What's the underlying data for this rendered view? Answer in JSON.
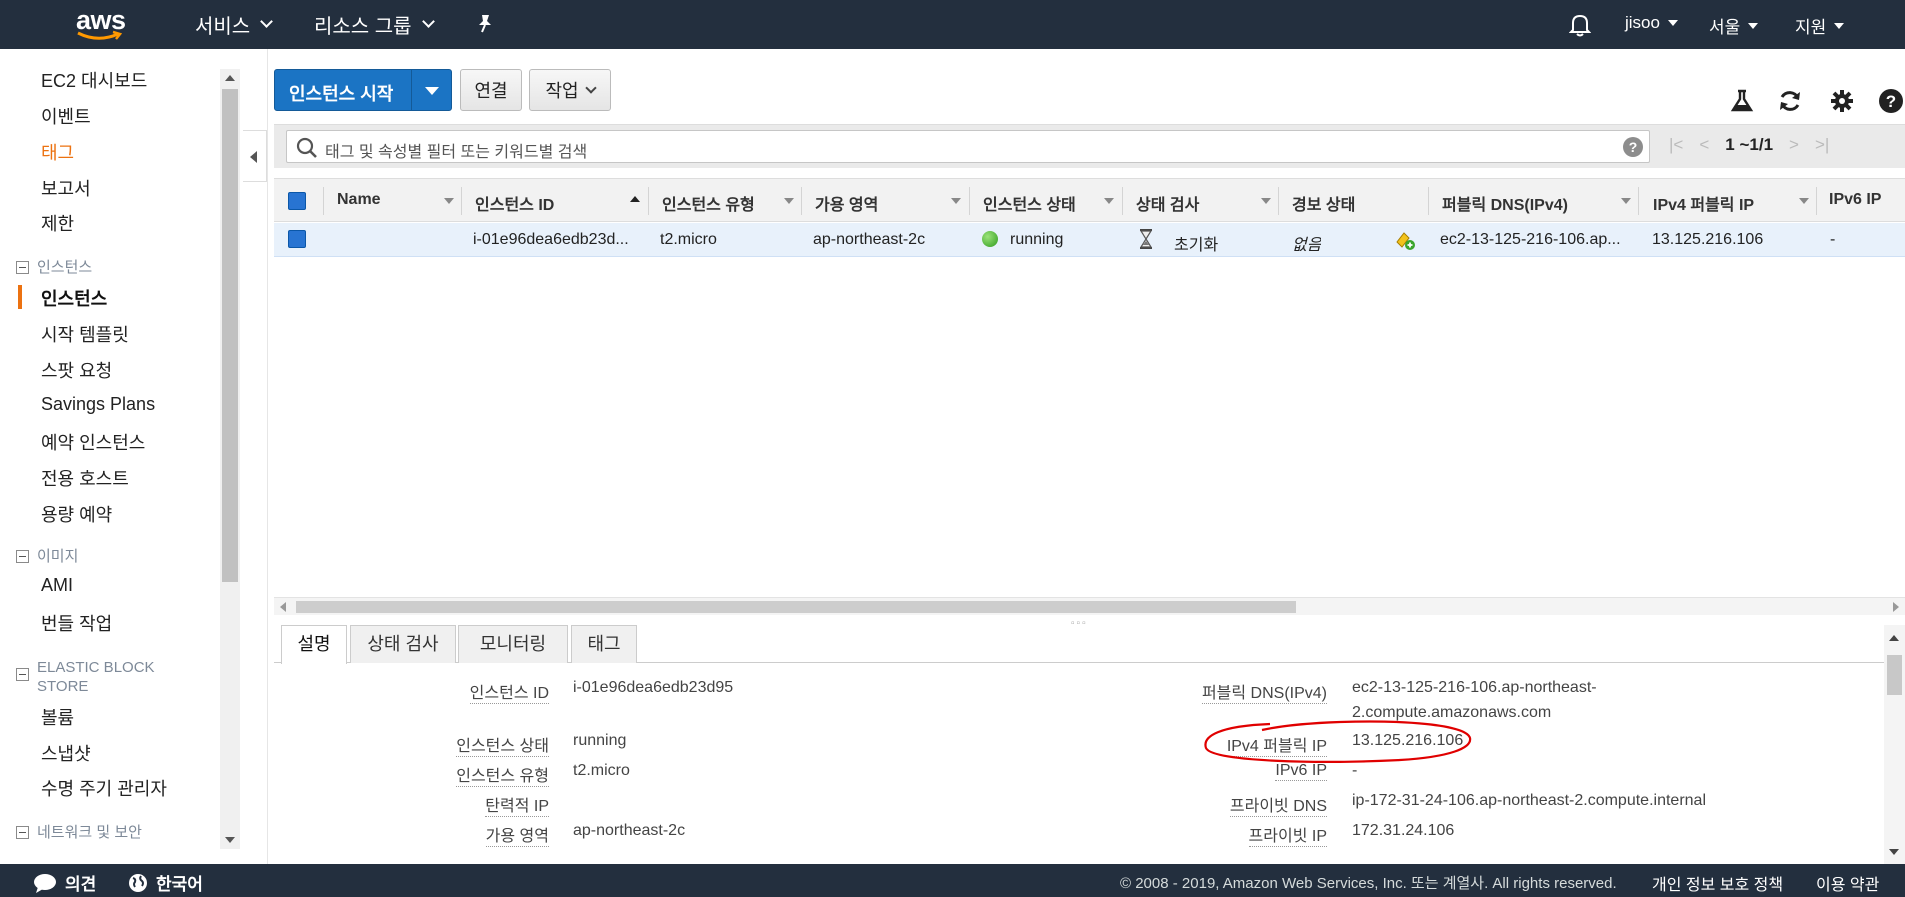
{
  "topnav": {
    "logo_text": "aws",
    "services": "서비스",
    "resource_groups": "리소스 그룹",
    "user": "jisoo",
    "region": "서울",
    "support": "지원"
  },
  "sidebar": {
    "items_top": [
      "EC2 대시보드",
      "이벤트",
      "태그",
      "보고서",
      "제한"
    ],
    "sections": {
      "instances": "인스턴스",
      "images": "이미지",
      "ebs": "ELASTIC BLOCK STORE",
      "network": "네트워크 및 보안"
    },
    "instances_items": [
      "인스턴스",
      "시작 템플릿",
      "스팟 요청",
      "Savings Plans",
      "예약 인스턴스",
      "전용 호스트",
      "용량 예약"
    ],
    "images_items": [
      "AMI",
      "번들 작업"
    ],
    "ebs_items": [
      "볼륨",
      "스냅샷",
      "수명 주기 관리자"
    ]
  },
  "toolbar": {
    "launch": "인스턴스 시작",
    "connect": "연결",
    "actions": "작업"
  },
  "search": {
    "placeholder": "태그 및 속성별 필터 또는 키워드별 검색",
    "pager": "1 ~1/1"
  },
  "grid": {
    "columns": [
      "Name",
      "인스턴스 ID",
      "인스턴스 유형",
      "가용 영역",
      "인스턴스 상태",
      "상태 검사",
      "경보 상태",
      "퍼블릭 DNS(IPv4)",
      "IPv4 퍼블릭 IP",
      "IPv6 IP"
    ],
    "rows": [
      {
        "name": "",
        "instance_id": "i-01e96dea6edb23d...",
        "type": "t2.micro",
        "az": "ap-northeast-2c",
        "state": "running",
        "status_check": "초기화",
        "alarm": "없음",
        "public_dns": "ec2-13-125-216-106.ap...",
        "public_ip": "13.125.216.106",
        "ipv6": "-"
      }
    ]
  },
  "detail": {
    "tabs": [
      "설명",
      "상태 검사",
      "모니터링",
      "태그"
    ],
    "left": [
      {
        "label": "인스턴스 ID",
        "value": "i-01e96dea6edb23d95"
      },
      {
        "label": "인스턴스 상태",
        "value": "running"
      },
      {
        "label": "인스턴스 유형",
        "value": "t2.micro"
      },
      {
        "label": "탄력적 IP",
        "value": ""
      },
      {
        "label": "가용 영역",
        "value": "ap-northeast-2c"
      }
    ],
    "right": [
      {
        "label": "퍼블릭 DNS(IPv4)",
        "value": "ec2-13-125-216-106.ap-northeast-",
        "value2": "2.compute.amazonaws.com"
      },
      {
        "label": "IPv4 퍼블릭 IP",
        "value": "13.125.216.106"
      },
      {
        "label": "IPv6 IP",
        "value": "-"
      },
      {
        "label": "프라이빗 DNS",
        "value": "ip-172-31-24-106.ap-northeast-2.compute.internal"
      },
      {
        "label": "프라이빗 IP",
        "value": "172.31.24.106"
      }
    ]
  },
  "footer": {
    "feedback": "의견",
    "language": "한국어",
    "copyright": "© 2008 - 2019, Amazon Web Services, Inc. 또는 계열사. All rights reserved.",
    "privacy": "개인 정보 보호 정책",
    "terms": "이용 약관"
  },
  "colors": {
    "nav_bg": "#232f3e",
    "primary": "#1b74c4",
    "accent_orange": "#ec7211",
    "annotation_red": "#e00000"
  }
}
